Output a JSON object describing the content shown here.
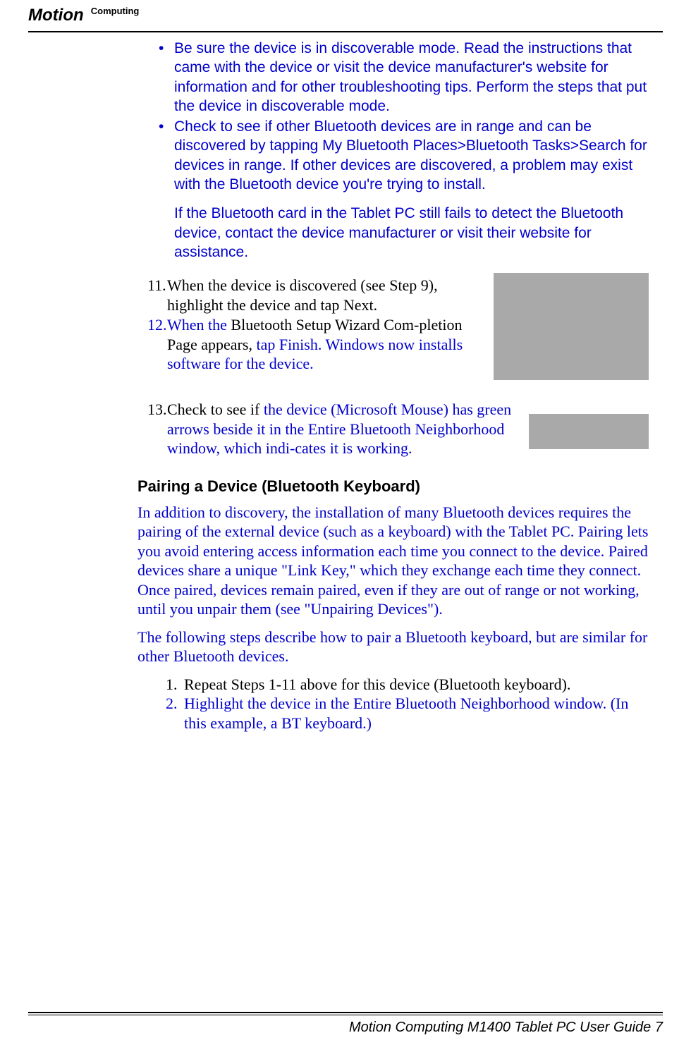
{
  "logo": {
    "motion": "Motion",
    "computing": "Computing"
  },
  "bullets": [
    "Be sure the device is in discoverable mode. Read the instructions that came with the device or visit the device manufacturer's website for information and for other troubleshooting tips. Perform the steps that put the device in discoverable mode.",
    "Check to see if other Bluetooth devices are in range and can be discovered by tapping My Bluetooth Places>Bluetooth Tasks>Search for devices in range. If other devices are discovered, a problem may exist with the Bluetooth device you're trying to install."
  ],
  "bullet_note": "If the Bluetooth card in the Tablet PC still fails to detect the Bluetooth device, contact the device manufacturer or visit their website for assistance.",
  "step11": {
    "num": "11.",
    "text": "When the device is discovered (see Step 9), highlight the device and tap Next."
  },
  "step12": {
    "num": "12.",
    "prefix": "When the ",
    "mid": "Bluetooth Setup Wizard Com-pletion Page appears, ",
    "suffix": "tap Finish. Windows now installs software for the device."
  },
  "step13": {
    "num": "13.",
    "prefix": "Check to see if ",
    "suffix": "the device (Microsoft Mouse) has green arrows beside it in the Entire Bluetooth Neighborhood window, which indi-cates it is working."
  },
  "heading": "Pairing a Device (Bluetooth Keyboard)",
  "para1": "In addition to discovery, the installation of many Bluetooth devices requires the pairing of the external device (such as a keyboard) with the Tablet PC. Pairing lets you avoid entering access information each time you connect to the device. Paired devices share a unique \"Link Key,\" which they exchange each time they connect. Once paired, devices remain paired, even if they are out of range or not working, until you unpair them (see \"Unpairing Devices\").",
  "para2": "The following steps describe how to pair a Bluetooth keyboard, but are similar for other Bluetooth devices.",
  "steps2": [
    {
      "num": "1.",
      "text": "Repeat Steps 1-11 above for this device (Bluetooth keyboard).",
      "color": "black"
    },
    {
      "num": "2.",
      "text": "Highlight the device in the Entire Bluetooth Neighborhood window. (In this example, a BT keyboard.)",
      "color": "blue"
    }
  ],
  "footer": {
    "text": "Motion Computing M1400 Tablet PC User Guide",
    "page": "7"
  }
}
